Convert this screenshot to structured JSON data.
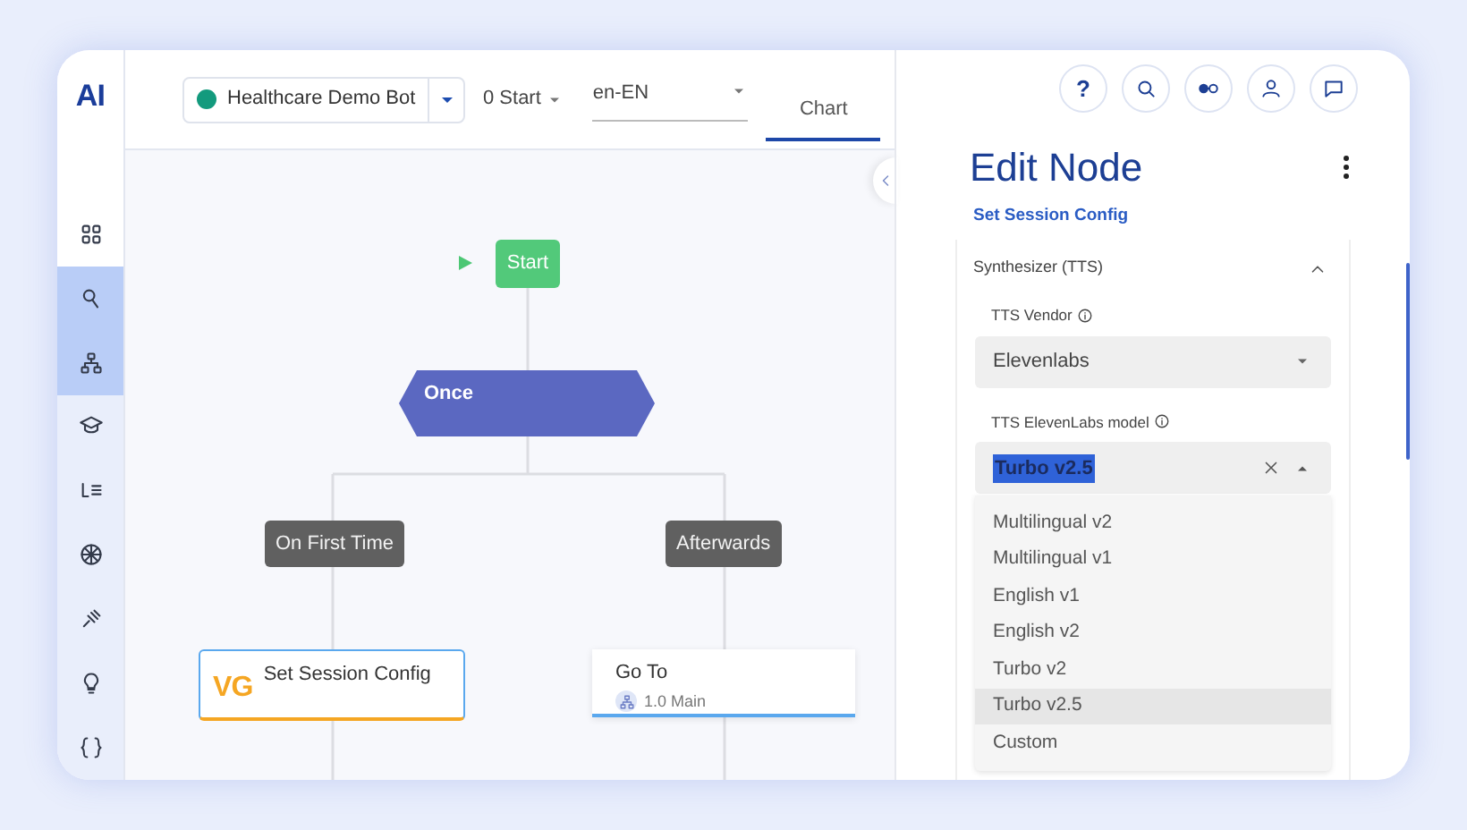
{
  "logo": "AI",
  "sidebar": {
    "items": [
      {
        "selected": false
      },
      {
        "selected": true
      },
      {
        "selected": true
      },
      {
        "selected": false
      },
      {
        "selected": false
      },
      {
        "selected": false
      },
      {
        "selected": false
      },
      {
        "selected": false
      },
      {
        "selected": false
      }
    ]
  },
  "toolbar": {
    "bot": {
      "name": "Healthcare Demo Bot"
    },
    "flow": "0 Start",
    "locale": "en-EN",
    "tabs": [
      {
        "label": "Chart",
        "selected": true
      }
    ]
  },
  "canvas": {
    "nodes": [
      {
        "kind": "start",
        "label": "Start"
      },
      {
        "kind": "condition",
        "label": "Once"
      },
      {
        "kind": "branch",
        "label": "On First Time"
      },
      {
        "kind": "branch",
        "label": "Afterwards"
      },
      {
        "kind": "action",
        "badge": "VG",
        "label": "Set Session Config",
        "selected": true
      },
      {
        "kind": "goto",
        "label": "Go To",
        "target": "1.0 Main",
        "selected": false
      }
    ]
  },
  "panel": {
    "header_buttons": [
      {
        "kind": "help",
        "label": "?"
      },
      {
        "kind": "search"
      },
      {
        "kind": "toggle"
      },
      {
        "kind": "user"
      },
      {
        "kind": "chat"
      }
    ],
    "title": "Edit Node",
    "subtitle": "Set Session Config",
    "section": {
      "title": "Synthesizer (TTS)",
      "expanded": true,
      "fields": [
        {
          "kind": "select",
          "label": "TTS Vendor",
          "value": "Elevenlabs"
        },
        {
          "kind": "combobox",
          "label": "TTS ElevenLabs model",
          "value": "Turbo v2.5",
          "open": true,
          "options": [
            {
              "label": "Multilingual v2",
              "selected": false
            },
            {
              "label": "Multilingual v1",
              "selected": false
            },
            {
              "label": "English v1",
              "selected": false
            },
            {
              "label": "English v2",
              "selected": false
            },
            {
              "label": "Turbo v2",
              "selected": false
            },
            {
              "label": "Turbo v2.5",
              "selected": true
            },
            {
              "label": "Custom",
              "selected": false
            }
          ]
        }
      ]
    }
  }
}
